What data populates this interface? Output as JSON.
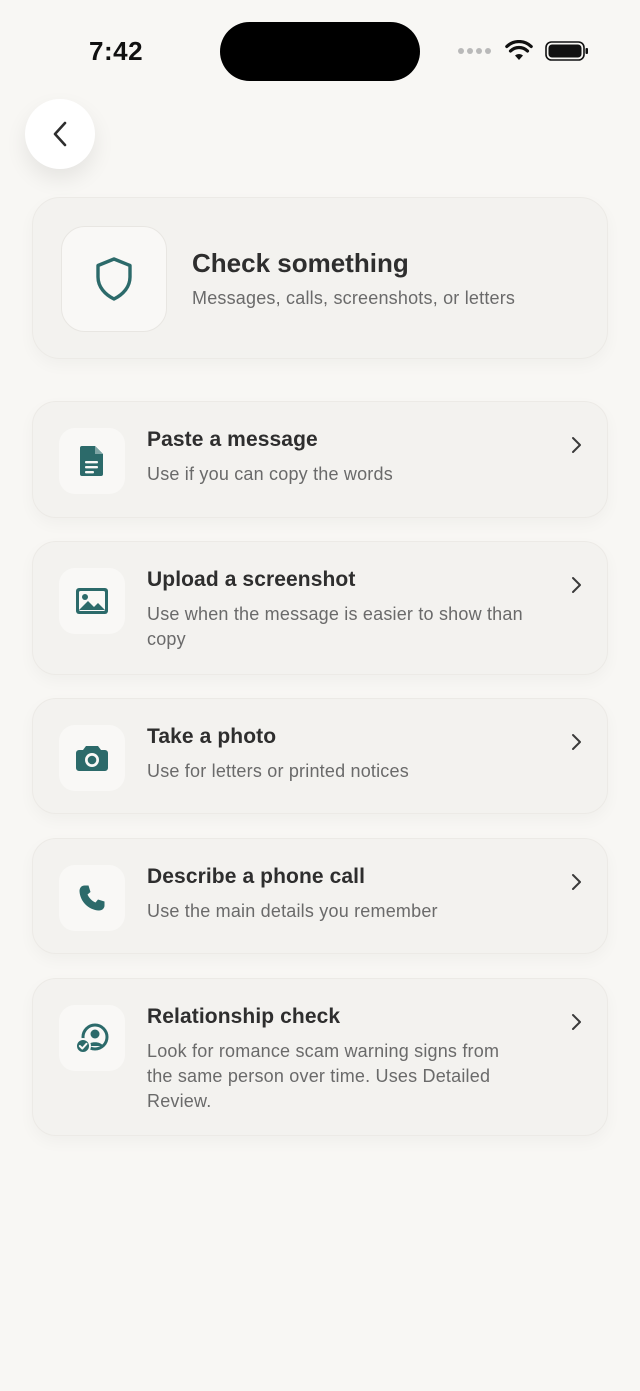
{
  "status_bar": {
    "time": "7:42"
  },
  "header": {
    "title": "Check something",
    "subtitle": "Messages, calls, screenshots, or letters"
  },
  "options": [
    {
      "title": "Paste a message",
      "description": "Use if you can copy the words",
      "icon": "document-icon"
    },
    {
      "title": "Upload a screenshot",
      "description": "Use when the message is easier to show than copy",
      "icon": "image-icon"
    },
    {
      "title": "Take a photo",
      "description": "Use for letters or printed notices",
      "icon": "camera-icon"
    },
    {
      "title": "Describe a phone call",
      "description": "Use the main details you remember",
      "icon": "phone-icon"
    },
    {
      "title": "Relationship check",
      "description": "Look for romance scam warning signs from the same person over time. Uses Detailed Review.",
      "icon": "person-check-icon"
    }
  ],
  "colors": {
    "accent": "#2c6a6a",
    "background": "#f8f7f4",
    "card": "#f3f2ef"
  }
}
